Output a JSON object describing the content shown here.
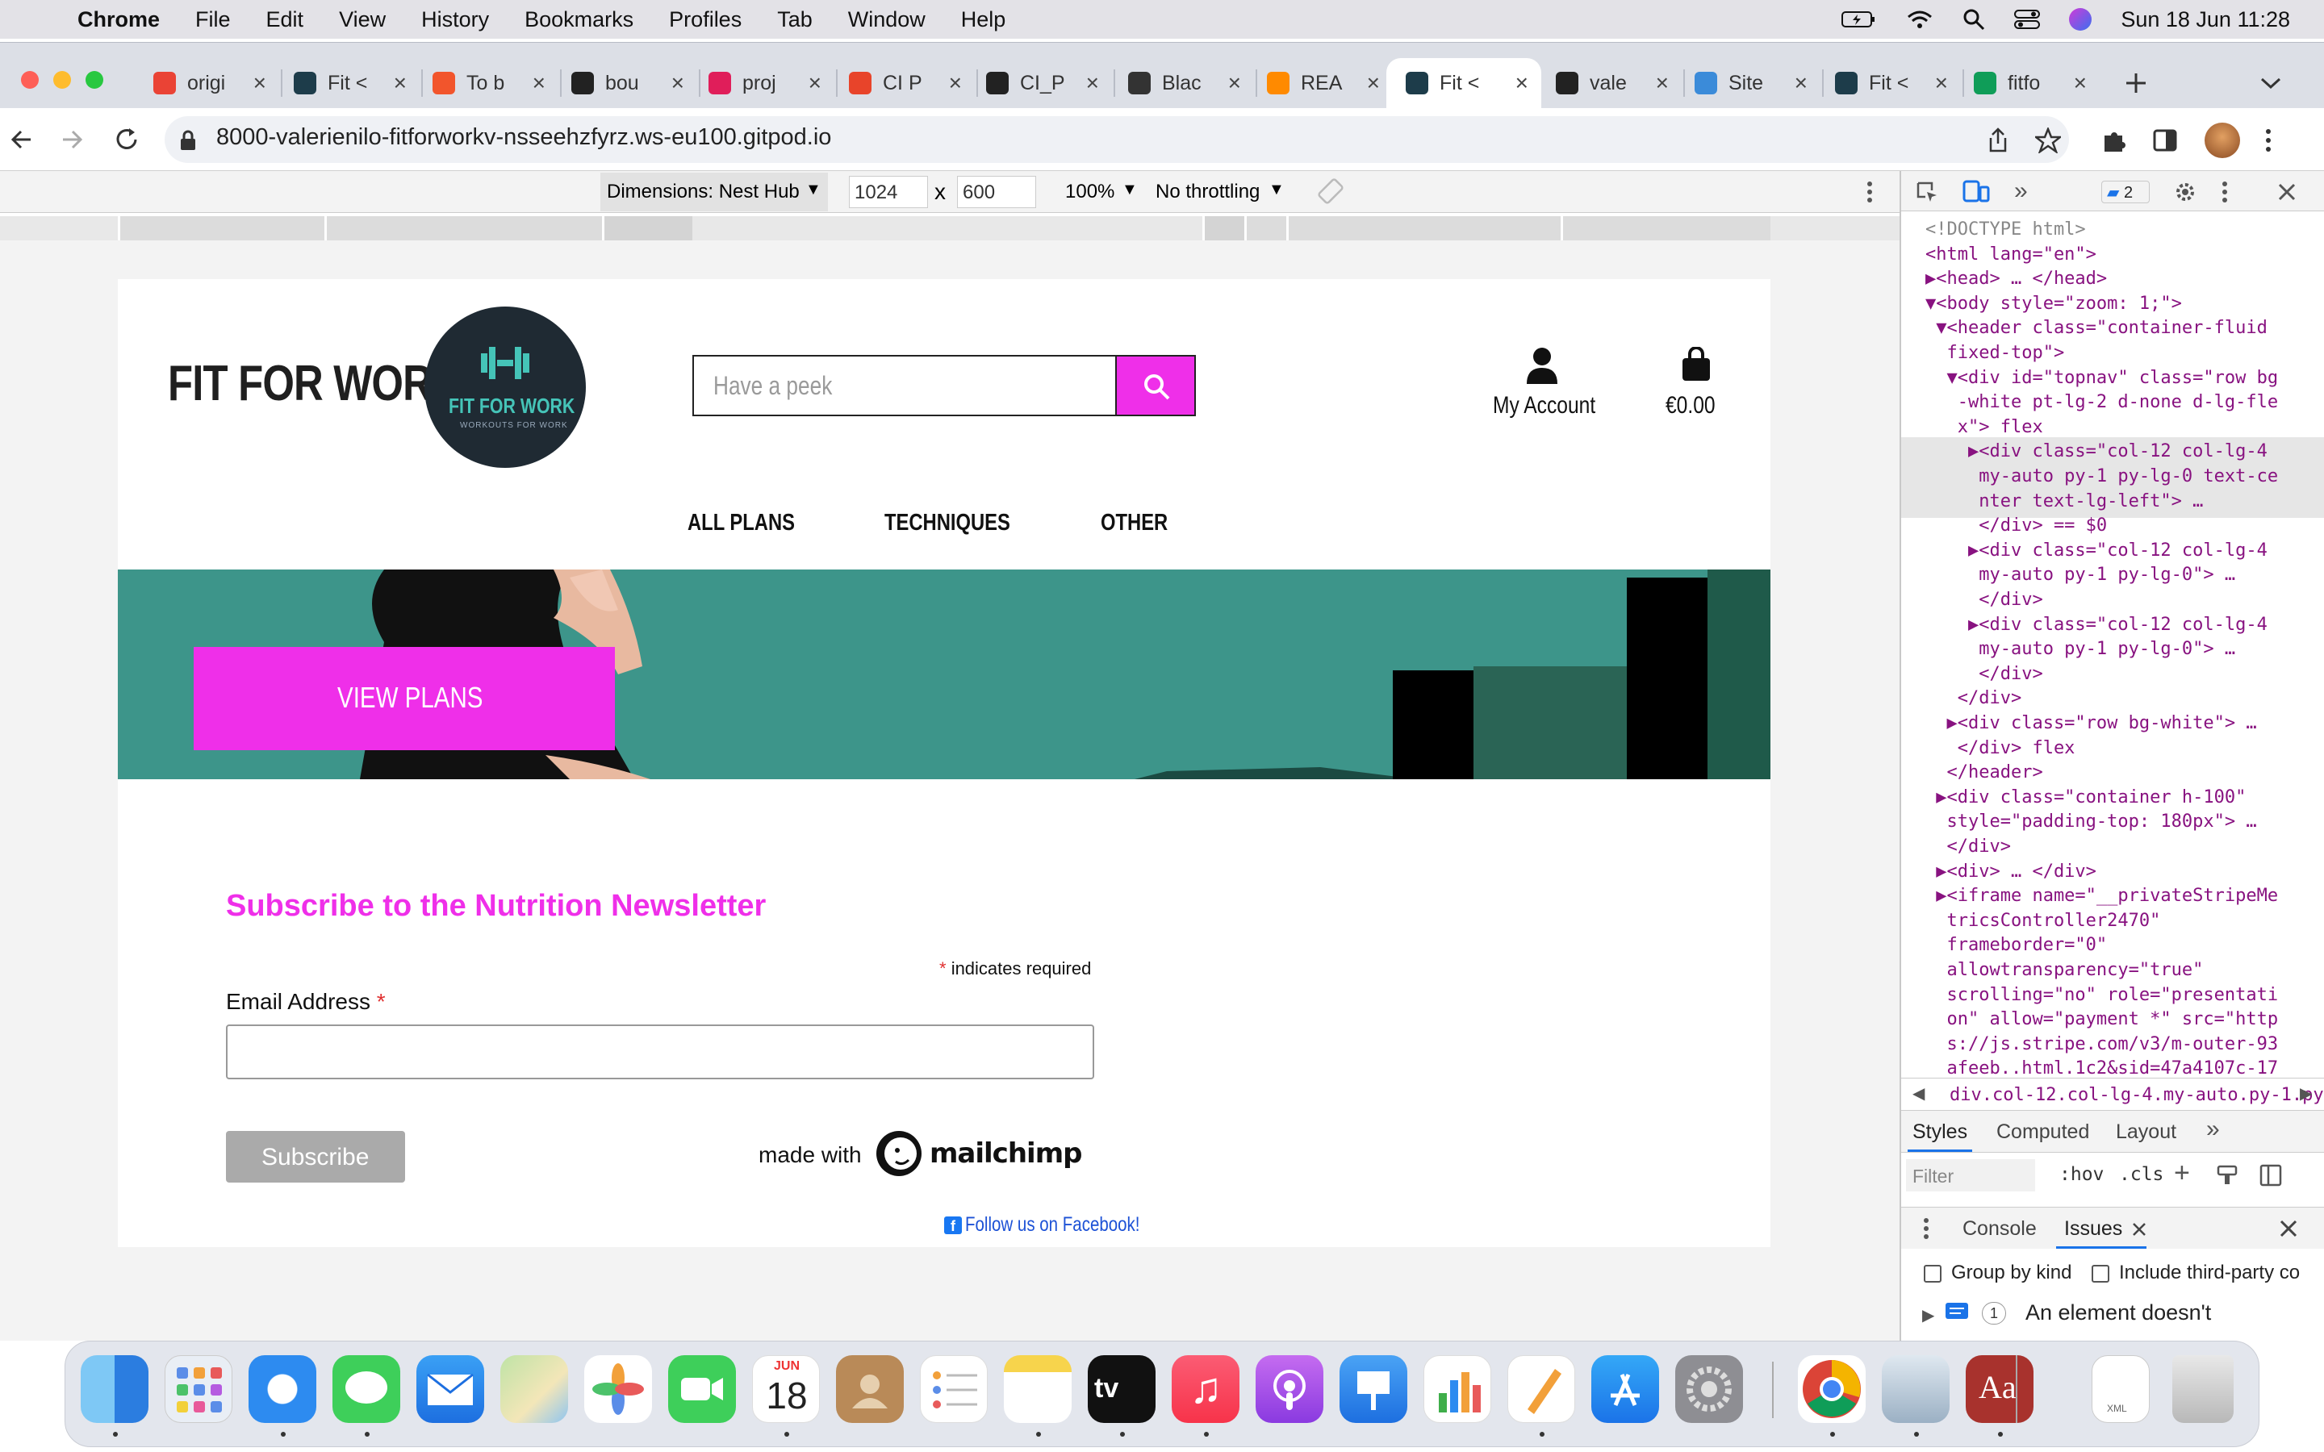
{
  "menubar": {
    "app_name": "Chrome",
    "items": [
      "File",
      "Edit",
      "View",
      "History",
      "Bookmarks",
      "Profiles",
      "Tab",
      "Window",
      "Help"
    ],
    "datetime": "Sun 18 Jun  11:28"
  },
  "tabs": [
    {
      "label": "origi",
      "icon": "gmail-icon",
      "color": "#ea4335"
    },
    {
      "label": "Fit <",
      "icon": "site-icon",
      "color": "#1d3c4a"
    },
    {
      "label": "To b",
      "icon": "circle-icon",
      "color": "#f2552c"
    },
    {
      "label": "bou",
      "icon": "github-icon",
      "color": "#222"
    },
    {
      "label": "proj",
      "icon": "slack-icon",
      "color": "#e01e5a"
    },
    {
      "label": "CI P",
      "icon": "circle-icon",
      "color": "#e8442a"
    },
    {
      "label": "CI_P",
      "icon": "github-icon",
      "color": "#222"
    },
    {
      "label": "Blac",
      "icon": "square-icon",
      "color": "#333"
    },
    {
      "label": "REA",
      "icon": "gitpod-icon",
      "color": "#ff8a00"
    },
    {
      "label": "Fit <",
      "icon": "site-icon",
      "color": "#1d3c4a",
      "active": true
    },
    {
      "label": "vale",
      "icon": "github-icon",
      "color": "#222"
    },
    {
      "label": "Site",
      "icon": "globe-icon",
      "color": "#3b8bd9"
    },
    {
      "label": "Fit <",
      "icon": "site-icon",
      "color": "#1d3c4a"
    },
    {
      "label": "fitfo",
      "icon": "sheet-icon",
      "color": "#0f9d58"
    }
  ],
  "address": {
    "url": "8000-valerienilo-fitforworkv-nsseehzfyrz.ws-eu100.gitpod.io"
  },
  "device_toolbar": {
    "dimensions_label": "Dimensions: Nest Hub",
    "width": "1024",
    "height": "600",
    "times": "x",
    "zoom": "100%",
    "throttling": "No throttling"
  },
  "site": {
    "brand": "FIT FOR WORK",
    "logo_title": "FIT FOR WORK",
    "logo_sub": "WORKOUTS FOR WORK",
    "search_placeholder": "Have a peek",
    "account_label": "My Account",
    "cart_total": "€0.00",
    "nav": [
      "ALL PLANS",
      "TECHNIQUES",
      "OTHER"
    ],
    "hero_button": "VIEW PLANS",
    "newsletter_title": "Subscribe to the Nutrition Newsletter",
    "required_asterisk": "*",
    "required_note": "indicates required",
    "email_label": "Email Address",
    "subscribe_button": "Subscribe",
    "made_with": "made with",
    "mailchimp": "mailchimp",
    "facebook_link": "Follow us on Facebook!",
    "colors": {
      "accent": "#ef2fe9",
      "teal": "#3d958a",
      "dark": "#1f2a33"
    }
  },
  "devtools": {
    "badge_count": "2",
    "dom_lines": [
      {
        "text": "<!DOCTYPE html>",
        "cls": "gr"
      },
      {
        "text": "<html lang=\"en\">",
        "cls": "tag"
      },
      {
        "text": "▶<head> … </head>",
        "cls": "tag"
      },
      {
        "text": "▼<body style=\"zoom: 1;\">",
        "cls": "tag"
      },
      {
        "text": " ▼<header class=\"container-fluid",
        "cls": "tag"
      },
      {
        "text": "  fixed-top\">",
        "cls": "tag"
      },
      {
        "text": "  ▼<div id=\"topnav\" class=\"row bg",
        "cls": "tag"
      },
      {
        "text": "   -white pt-lg-2 d-none d-lg-fle",
        "cls": "tag"
      },
      {
        "text": "   x\"> flex",
        "cls": "tag"
      },
      {
        "text": "    ▶<div class=\"col-12 col-lg-4",
        "cls": "tag"
      },
      {
        "text": "     my-auto py-1 py-lg-0 text-ce",
        "cls": "tag"
      },
      {
        "text": "     nter text-lg-left\"> …",
        "cls": "tag"
      },
      {
        "text": "     </div> == $0",
        "cls": "tag"
      },
      {
        "text": "    ▶<div class=\"col-12 col-lg-4",
        "cls": "tag"
      },
      {
        "text": "     my-auto py-1 py-lg-0\"> …",
        "cls": "tag"
      },
      {
        "text": "     </div>",
        "cls": "tag"
      },
      {
        "text": "    ▶<div class=\"col-12 col-lg-4",
        "cls": "tag"
      },
      {
        "text": "     my-auto py-1 py-lg-0\"> …",
        "cls": "tag"
      },
      {
        "text": "     </div>",
        "cls": "tag"
      },
      {
        "text": "   </div>",
        "cls": "tag"
      },
      {
        "text": "  ▶<div class=\"row bg-white\"> …",
        "cls": "tag"
      },
      {
        "text": "   </div> flex",
        "cls": "tag"
      },
      {
        "text": "  </header>",
        "cls": "tag"
      },
      {
        "text": " ▶<div class=\"container h-100\"",
        "cls": "tag"
      },
      {
        "text": "  style=\"padding-top: 180px\"> …",
        "cls": "tag"
      },
      {
        "text": "  </div>",
        "cls": "tag"
      },
      {
        "text": " ▶<div> … </div>",
        "cls": "tag"
      },
      {
        "text": " ▶<iframe name=\"__privateStripeMe",
        "cls": "tag"
      },
      {
        "text": "  tricsController2470\"",
        "cls": "tag"
      },
      {
        "text": "  frameborder=\"0\"",
        "cls": "tag"
      },
      {
        "text": "  allowtransparency=\"true\"",
        "cls": "tag"
      },
      {
        "text": "  scrolling=\"no\" role=\"presentati",
        "cls": "tag"
      },
      {
        "text": "  on\" allow=\"payment *\" src=\"http",
        "cls": "tag"
      },
      {
        "text": "  s://js.stripe.com/v3/m-outer-93",
        "cls": "tag"
      },
      {
        "text": "  afeeb..html.1c2&sid=47a4107c-17",
        "cls": "tag"
      }
    ],
    "breadcrumb": "div.col-12.col-lg-4.my-auto.py-1.py-",
    "style_tabs": [
      "Styles",
      "Computed",
      "Layout"
    ],
    "filter_placeholder": "Filter",
    "hov": ":hov",
    "cls": ".cls",
    "drawer_tabs": [
      "Console",
      "Issues"
    ],
    "group_by_kind": "Group by kind",
    "include_third_party": "Include third-party co",
    "issue_count": "1",
    "issue_text": "An element doesn't"
  },
  "dock": {
    "calendar_month": "JUN",
    "calendar_day": "18",
    "apps": [
      "finder",
      "launchpad",
      "safari",
      "messages",
      "mail",
      "maps",
      "photos",
      "facetime",
      "calendar",
      "contacts",
      "reminders",
      "notes",
      "tv",
      "music",
      "podcasts",
      "keynote",
      "numbers",
      "pages",
      "app-store",
      "system-preferences",
      "chrome",
      "preview",
      "dictionary",
      "xml-file",
      "trash"
    ]
  }
}
